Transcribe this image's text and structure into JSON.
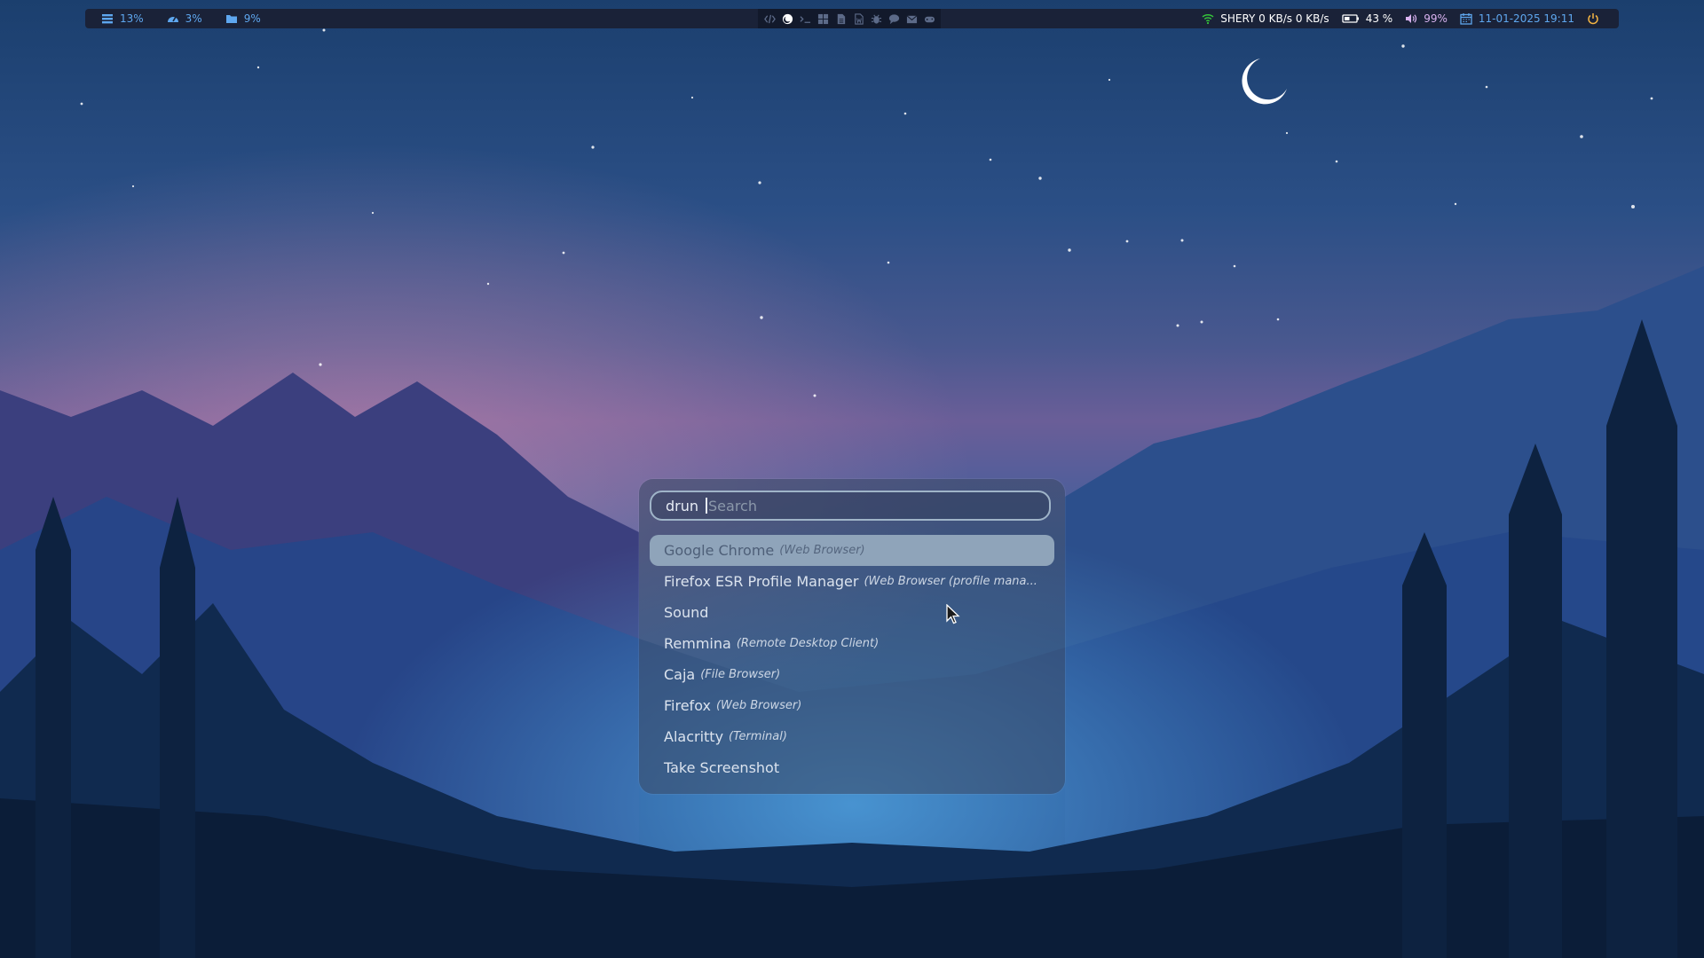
{
  "topbar": {
    "left_stats": [
      {
        "icon": "storage-icon",
        "value": "13%"
      },
      {
        "icon": "speedometer-icon",
        "value": "3%"
      },
      {
        "icon": "folder-icon",
        "value": "9%"
      }
    ],
    "workspaces": [
      "code-icon",
      "firefox-icon",
      "terminal-icon",
      "windows-icon",
      "document-icon",
      "word-icon",
      "bug-icon",
      "chat-icon",
      "mail-icon",
      "gamepad-icon"
    ],
    "active_workspace": 1,
    "network": {
      "icon": "wifi-icon",
      "text": "SHERY 0 KB/s 0 KB/s"
    },
    "battery": {
      "icon": "battery-icon",
      "value": "43 %"
    },
    "volume": {
      "icon": "volume-icon",
      "value": "99%"
    },
    "datetime": {
      "icon": "calendar-icon",
      "value": "11-01-2025 19:11"
    },
    "power": {
      "icon": "power-icon"
    },
    "colors": {
      "bar_bg": "#1a2238",
      "accent": "#5ea7ef",
      "power": "#f4b442"
    }
  },
  "launcher": {
    "prompt": "drun",
    "search_placeholder": "Search",
    "search_value": "",
    "selected_index": 0,
    "results": [
      {
        "name": "Google Chrome",
        "desc": "(Web Browser)"
      },
      {
        "name": "Firefox ESR Profile Manager",
        "desc": "(Web Browser (profile mana..."
      },
      {
        "name": "Sound",
        "desc": ""
      },
      {
        "name": "Remmina",
        "desc": "(Remote Desktop Client)"
      },
      {
        "name": "Caja",
        "desc": "(File Browser)"
      },
      {
        "name": "Firefox",
        "desc": "(Web Browser)"
      },
      {
        "name": "Alacritty",
        "desc": "(Terminal)"
      },
      {
        "name": "Take Screenshot",
        "desc": ""
      }
    ],
    "colors": {
      "selected_bg": "#8fa4ba",
      "border": "#9fb4c8"
    }
  }
}
